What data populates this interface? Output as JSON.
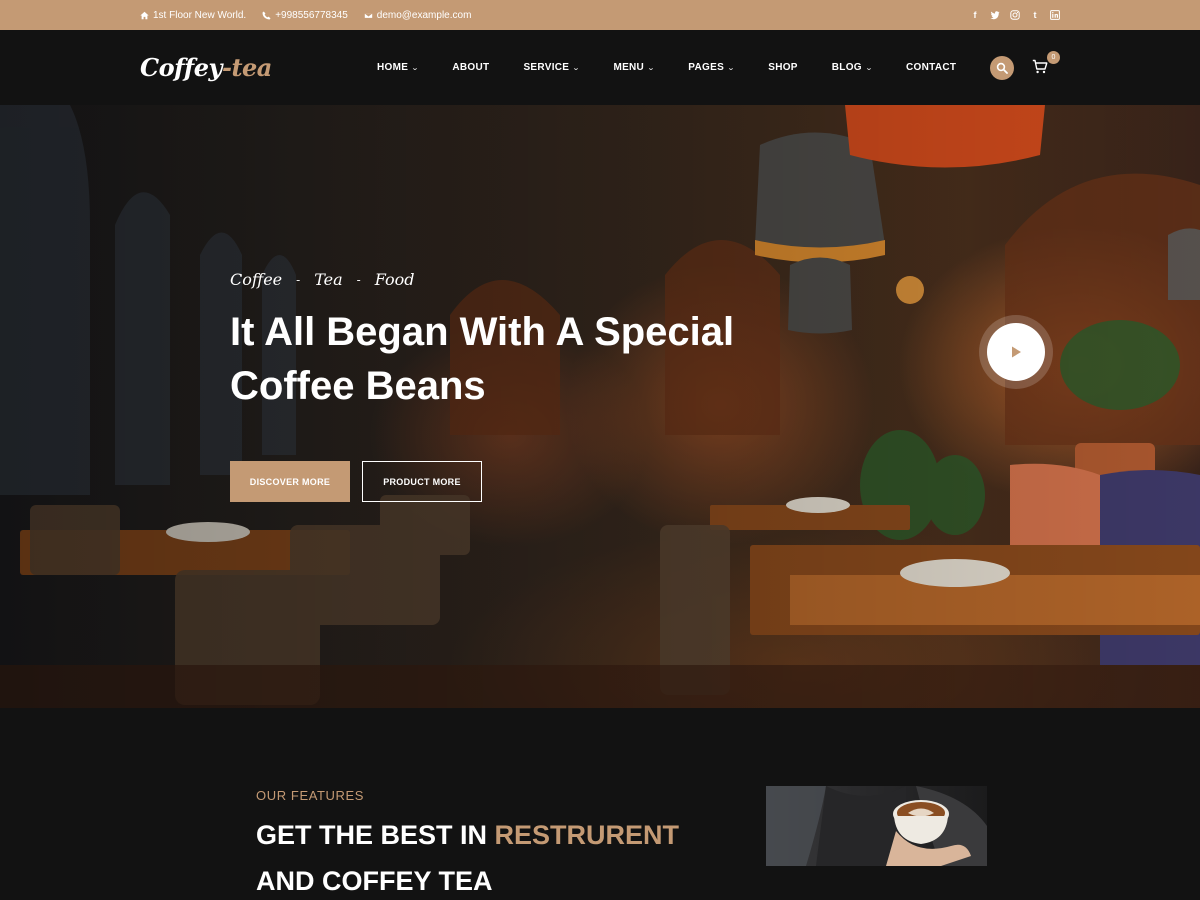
{
  "topbar": {
    "address": "1st Floor New World.",
    "phone": "+998556778345",
    "email": "demo@example.com",
    "social": [
      "facebook-icon",
      "twitter-icon",
      "instagram-icon",
      "tumblr-icon",
      "linkedin-icon"
    ]
  },
  "header": {
    "logo_main": "Coffey",
    "logo_sep": "-",
    "logo_accent": "tea",
    "nav": [
      {
        "label": "HOME",
        "dropdown": true
      },
      {
        "label": "ABOUT",
        "dropdown": false
      },
      {
        "label": "SERVICE",
        "dropdown": true
      },
      {
        "label": "MENU",
        "dropdown": true
      },
      {
        "label": "PAGES",
        "dropdown": true
      },
      {
        "label": "SHOP",
        "dropdown": false
      },
      {
        "label": "BLOG",
        "dropdown": true
      },
      {
        "label": "CONTACT",
        "dropdown": false
      }
    ],
    "cart_count": "0"
  },
  "hero": {
    "tagline": [
      "Coffee",
      "Tea",
      "Food"
    ],
    "tagline_sep": "-",
    "title": "It All Began With A Special Coffee Beans",
    "primary_button": "DISCOVER MORE",
    "secondary_button": "PRODUCT MORE"
  },
  "features": {
    "kicker": "OUR FEATURES",
    "title_part1": "GET THE BEST IN ",
    "title_highlight": "RESTRURENT",
    "title_part2": " AND COFFEY TEA"
  },
  "colors": {
    "accent": "#c49a74",
    "dark": "#121212"
  }
}
